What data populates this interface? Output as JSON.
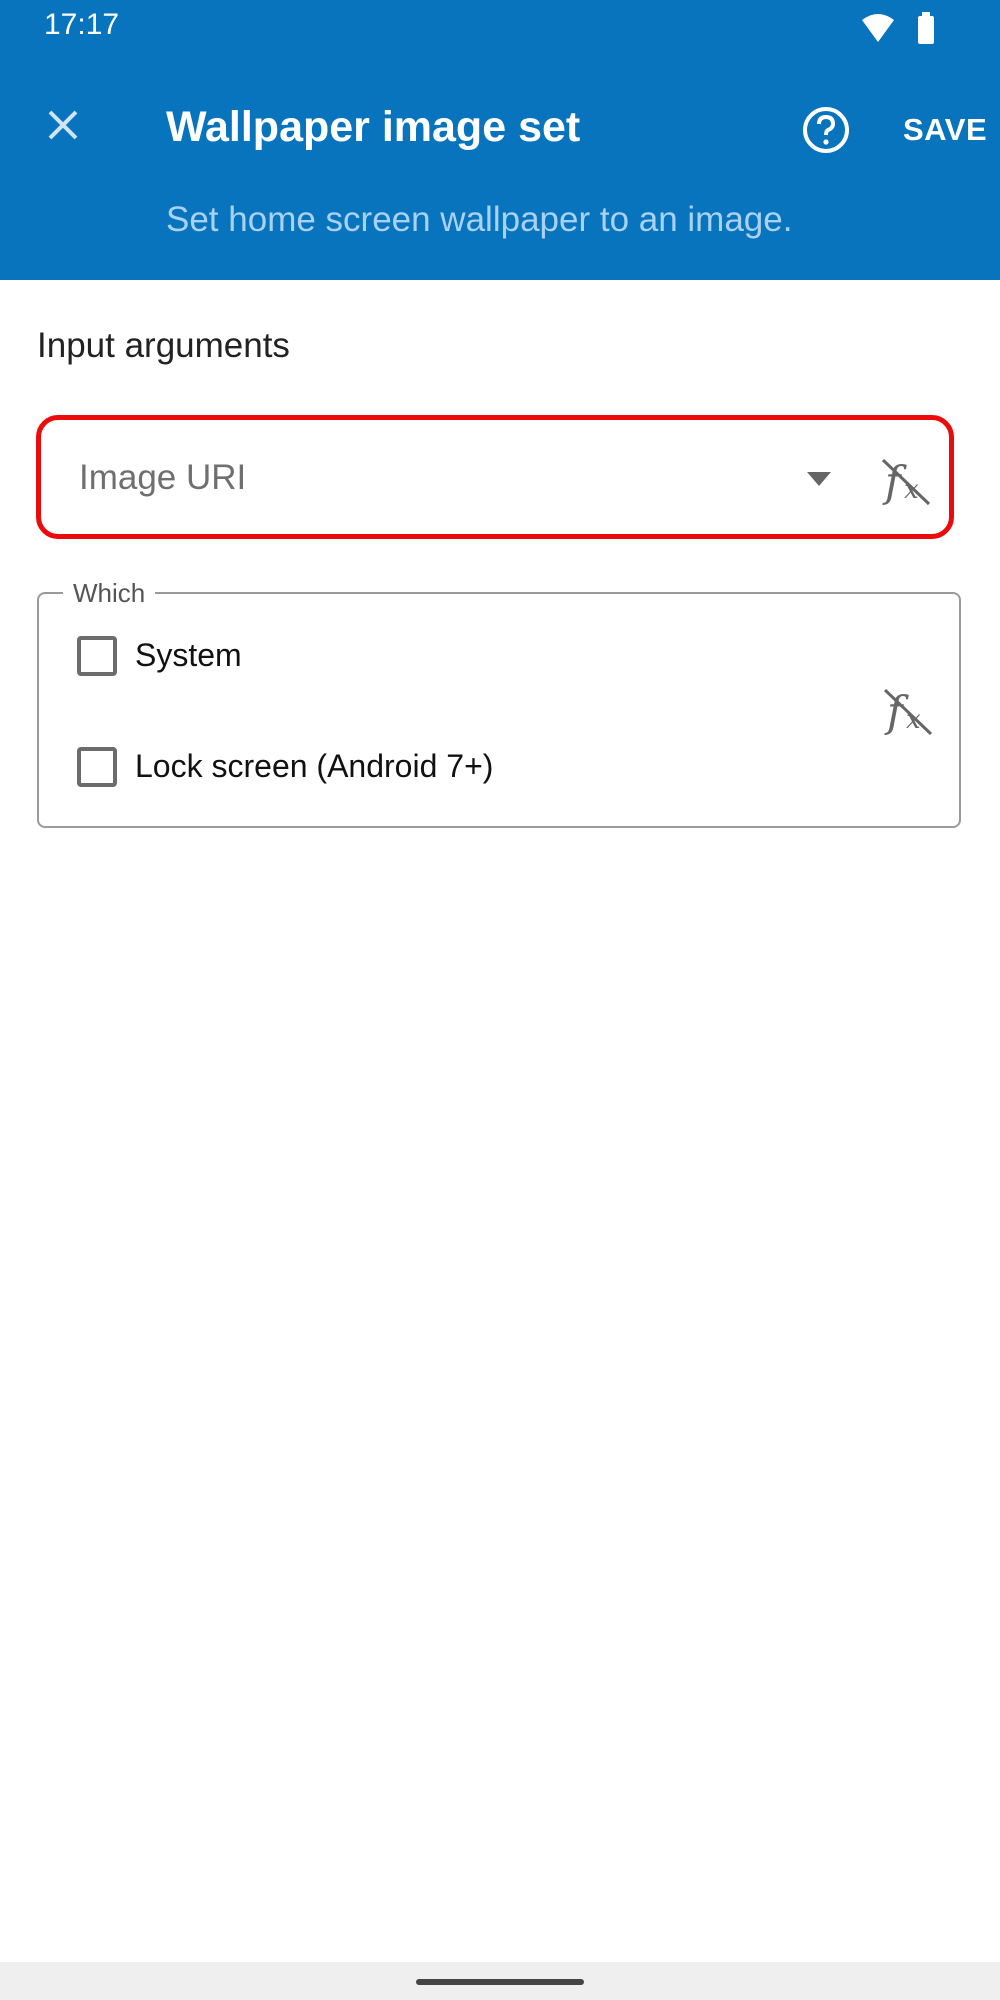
{
  "status_bar": {
    "time": "17:17",
    "icons": [
      "wifi-icon",
      "battery-icon"
    ]
  },
  "header": {
    "close_icon": "close-icon",
    "title": "Wallpaper image set",
    "help_icon": "help-circle-icon",
    "save_label": "SAVE",
    "subtitle": "Set home screen wallpaper to an image."
  },
  "main": {
    "section_heading": "Input arguments",
    "image_uri": {
      "placeholder": "Image URI",
      "value": "",
      "dropdown_icon": "chevron-down-icon",
      "fx_icon": "function-toggle-icon"
    },
    "which": {
      "legend": "Which",
      "options": [
        {
          "label": "System",
          "checked": false
        },
        {
          "label": "Lock screen (Android 7+)",
          "checked": false
        }
      ],
      "fx_icon": "function-toggle-icon"
    }
  },
  "colors": {
    "appbar": "#0874bd",
    "highlight_border": "#ec0b0b",
    "subtitle": "#a9d1f1"
  }
}
